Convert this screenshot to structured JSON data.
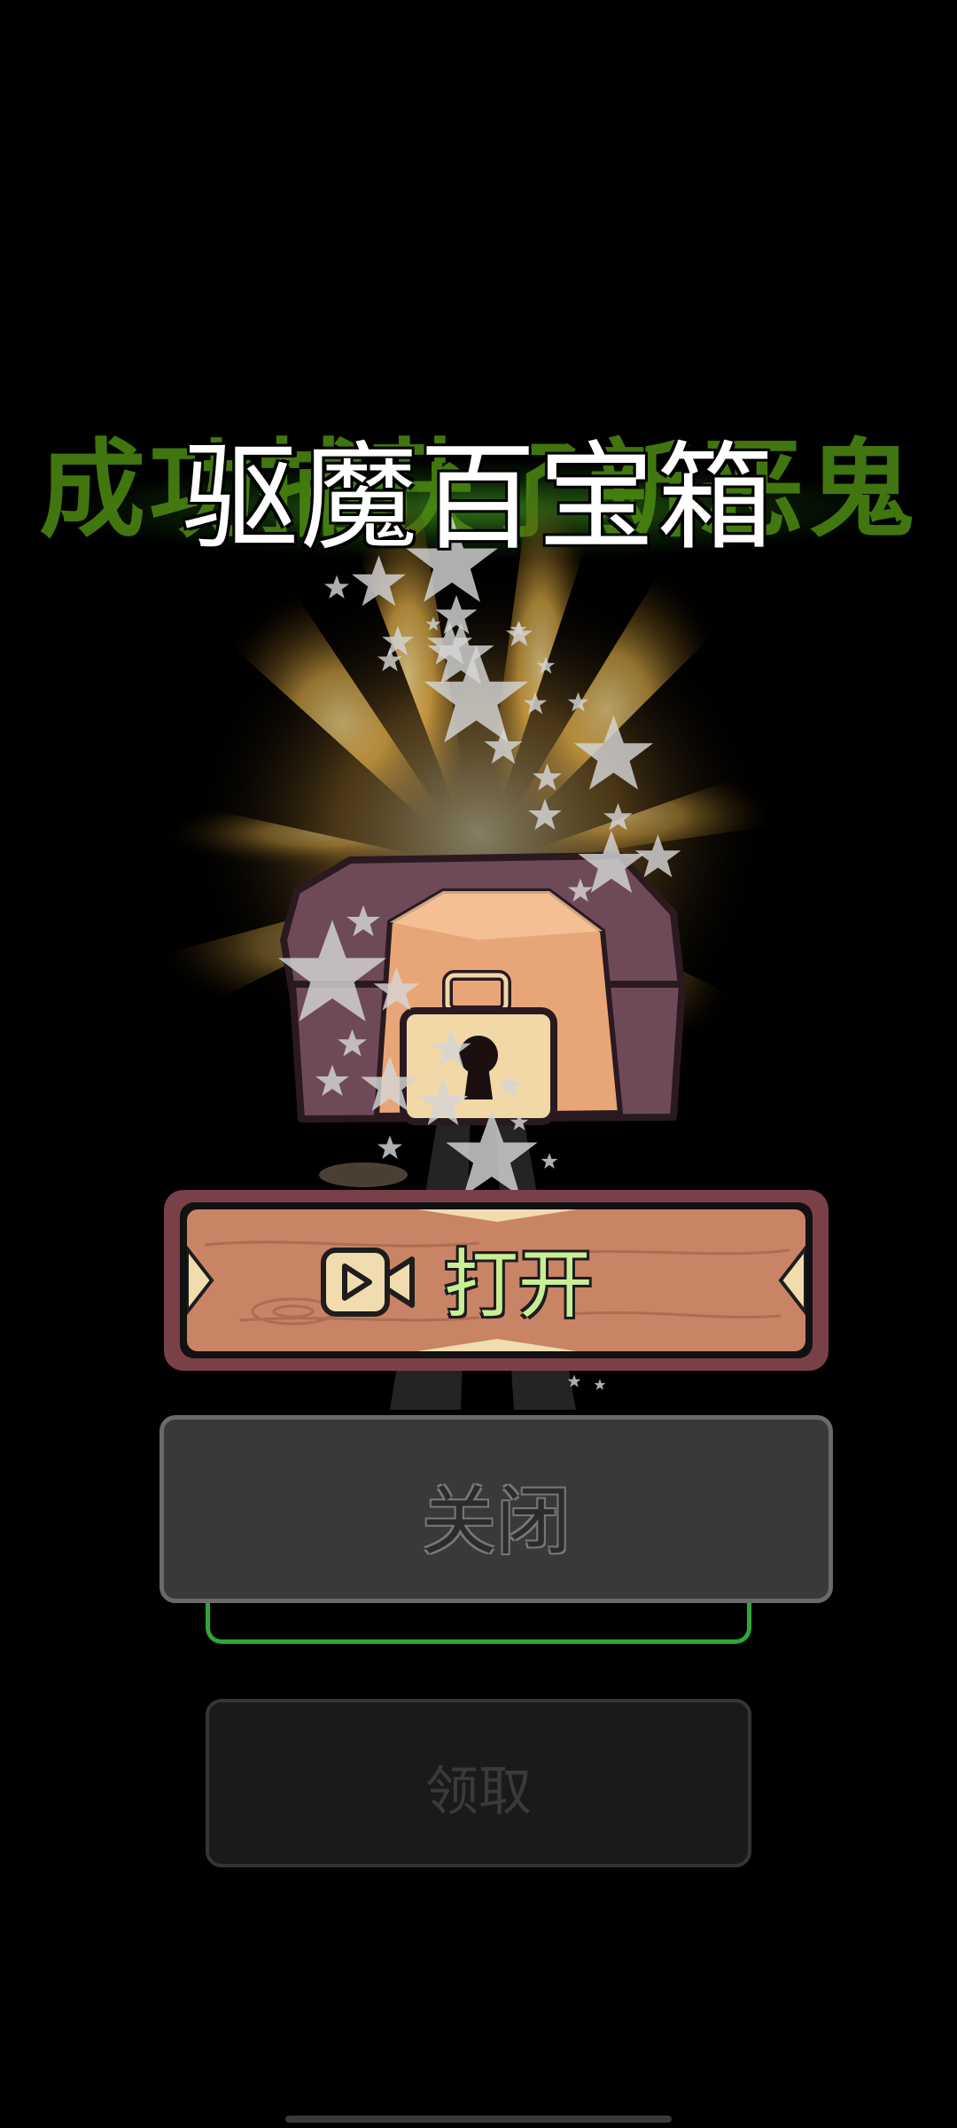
{
  "background_title": "成功捕获了新恶鬼",
  "title": "驱魔百宝箱",
  "buttons": {
    "open_label": "打开",
    "close_label": "关闭",
    "claim_label": "领取"
  },
  "icons": {
    "open_icon": "video-camera-icon"
  },
  "colors": {
    "title_glow": "#4d8a12",
    "open_label": "#c9ee95",
    "open_frame": "#7a4049",
    "wood": "#c98466",
    "green_border": "#2ca63a"
  }
}
